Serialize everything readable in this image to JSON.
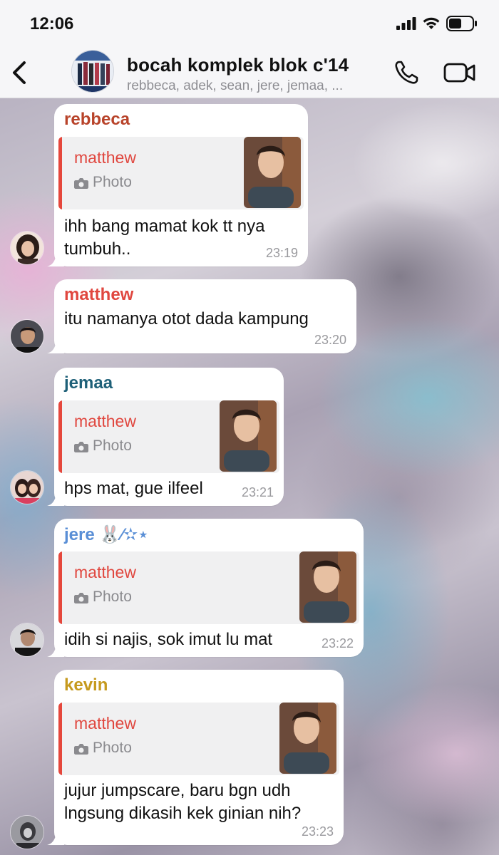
{
  "status_bar": {
    "time": "12:06"
  },
  "header": {
    "title": "bocah komplek blok c'14",
    "members": "rebbeca, adek, sean, jere, jemaa, ..."
  },
  "messages": [
    {
      "sender": "rebbeca",
      "sender_color": "#b8432a",
      "reply_author": "matthew",
      "reply_type": "Photo",
      "text": "ihh bang mamat kok tt nya tumbuh..",
      "time": "23:19"
    },
    {
      "sender": "matthew",
      "sender_color": "#e0473f",
      "text": "itu namanya otot dada kampung",
      "time": "23:20"
    },
    {
      "sender": "jemaa",
      "sender_color": "#1e6078",
      "reply_author": "matthew",
      "reply_type": "Photo",
      "text": "hps mat, gue ilfeel",
      "time": "23:21"
    },
    {
      "sender": "jere 🐰⁄✫⋆",
      "sender_color": "#5a8fd6",
      "reply_author": "matthew",
      "reply_type": "Photo",
      "text": "idih si najis, sok imut lu mat",
      "time": "23:22"
    },
    {
      "sender": "kevin",
      "sender_color": "#c69a1e",
      "reply_author": "matthew",
      "reply_type": "Photo",
      "text": "jujur jumpscare, baru bgn udh lngsung dikasih kek ginian nih?",
      "time": "23:23"
    }
  ],
  "colors": {
    "reply_accent": "#e5473c",
    "bubble": "#ffffff",
    "timestamp": "#9a9a9e"
  },
  "icons": [
    "signal-icon",
    "wifi-icon",
    "battery-icon",
    "back-icon",
    "phone-icon",
    "video-call-icon",
    "camera-icon"
  ]
}
